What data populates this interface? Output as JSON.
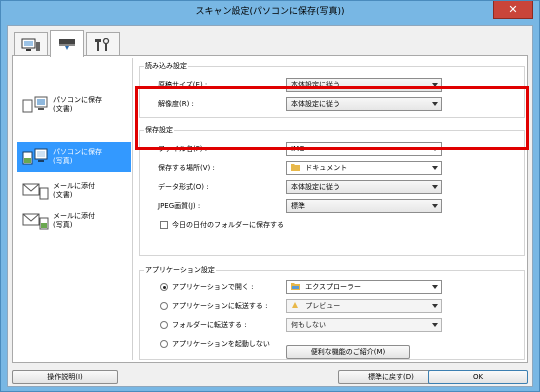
{
  "window": {
    "title": "スキャン設定(パソコンに保存(写真))",
    "close_label": "✕"
  },
  "tabs": [
    {
      "icon": "scanner-to-pc-icon"
    },
    {
      "icon": "scanner-icon"
    },
    {
      "icon": "tools-icon"
    }
  ],
  "sidebar": {
    "items": [
      {
        "icon": "save-document-to-pc-icon",
        "line1": "パソコンに保存",
        "line2": "(文書)"
      },
      {
        "icon": "save-photo-to-pc-icon",
        "line1": "パソコンに保存",
        "line2": "(写真)"
      },
      {
        "icon": "mail-document-icon",
        "line1": "メールに添付",
        "line2": "(文書)"
      },
      {
        "icon": "mail-photo-icon",
        "line1": "メールに添付",
        "line2": "(写真)"
      }
    ]
  },
  "scan_options": {
    "title": "読み込み設定",
    "paper_size_label": "原稿サイズ(E) :",
    "paper_size_value": "本体設定に従う",
    "resolution_label": "解像度(R) :",
    "resolution_value": "本体設定に従う"
  },
  "save_settings": {
    "title": "保存設定",
    "file_name_label": "ファイル名(F) :",
    "file_name_value": "IMG",
    "save_in_label": "保存する場所(V) :",
    "save_in_value": "ドキュメント",
    "data_format_label": "データ形式(O) :",
    "data_format_value": "本体設定に従う",
    "jpeg_quality_label": "JPEG画質(J) :",
    "jpeg_quality_value": "標準",
    "subfolder_checkbox_label": "今日の日付のフォルダーに保存する",
    "subfolder_checked": false
  },
  "app_settings": {
    "title": "アプリケーション設定",
    "open_with_label": "アプリケーションで開く :",
    "open_with_value": "エクスプローラー",
    "send_to_app_label": "アプリケーションに転送する :",
    "send_to_app_value": "プレビュー",
    "send_to_folder_label": "フォルダーに転送する :",
    "send_to_folder_value": "何もしない",
    "do_not_start_label": "アプリケーションを起動しない",
    "more_functions_label": "便利な機能のご紹介(M)",
    "selected_option": "open_with"
  },
  "footer": {
    "instructions_label": "操作説明(I)",
    "defaults_label": "標準に戻す(D)",
    "ok_label": "OK"
  },
  "colors": {
    "highlight": "#e00000",
    "selection": "#3399ff",
    "titlebar": "#78b7e4"
  }
}
